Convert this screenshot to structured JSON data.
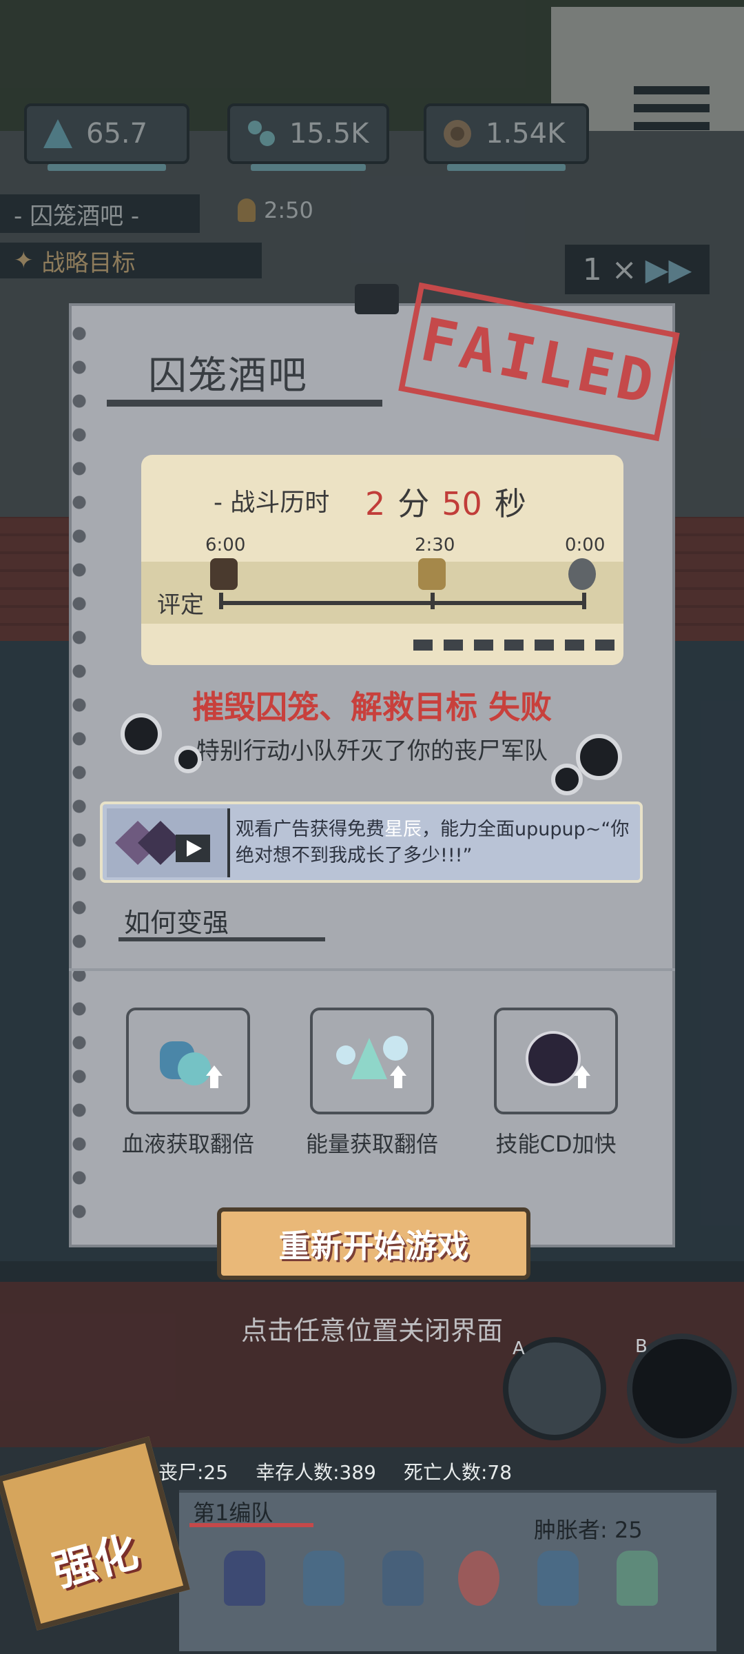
{
  "hud": {
    "energy": "65.7",
    "blood": "15.5K",
    "coins": "1.54K",
    "location": "- 囚笼酒吧 -",
    "timer": "2:50",
    "objective": "战略目标",
    "speed": "1 ×"
  },
  "result": {
    "level_title": "囚笼酒吧",
    "stamp": "FAILED",
    "battle_time_label": "- 战斗历时",
    "minutes": "2",
    "minutes_unit": "分",
    "seconds": "50",
    "seconds_unit": "秒",
    "ticks": [
      "6:00",
      "2:30",
      "0:00"
    ],
    "rating_label": "评定",
    "fail_message": "摧毁囚笼、解救目标 失败",
    "fail_reason": "特别行动小队歼灭了你的丧尸军队",
    "ad_text_part1": "观看广告获得免费",
    "ad_text_highlight": "星辰",
    "ad_text_part2": "，能力全面upupup~“你绝对想不到我成长了多少!!!”",
    "howto_title": "如何变强",
    "tips": [
      "血液获取翻倍",
      "能量获取翻倍",
      "技能CD加快"
    ],
    "restart_button": "重新开始游戏",
    "close_hint": "点击任意位置关闭界面"
  },
  "bottom": {
    "zombies": "丧尸:25",
    "survivors": "幸存人数:389",
    "dead": "死亡人数:78",
    "team_name": "第1编队",
    "bloat": "肿胀者: 25",
    "upgrade": "强化",
    "skill_a": "A",
    "skill_b": "B"
  },
  "colors": {
    "panel": "#a7aab0",
    "stamp": "#c5494a",
    "fail_text": "#c8403c",
    "button": "#e9b878"
  }
}
